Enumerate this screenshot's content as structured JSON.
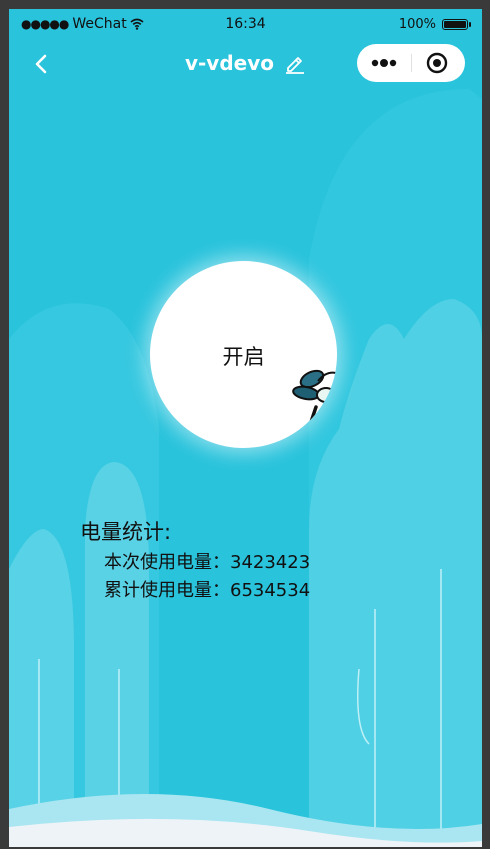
{
  "status_bar": {
    "signal": "●●●●●",
    "carrier": "WeChat",
    "time": "16:34",
    "battery": "100%"
  },
  "nav": {
    "title": "v-vdevo"
  },
  "main": {
    "start_button_label": "开启"
  },
  "stats": {
    "heading": "电量统计:",
    "rows": [
      {
        "label": "本次使用电量：",
        "value": "3423423"
      },
      {
        "label": "累计使用电量：",
        "value": "6534534"
      }
    ]
  },
  "colors": {
    "background": "#29c3dc",
    "hill": "#56d3e6",
    "card": "#ffffff"
  }
}
